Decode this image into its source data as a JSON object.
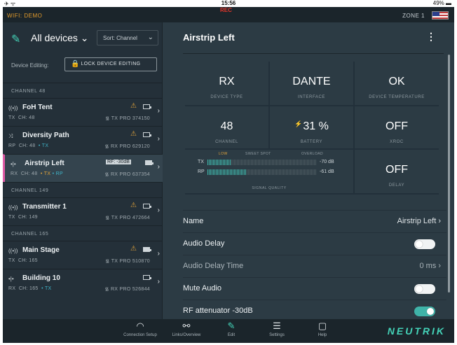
{
  "status_bar": {
    "left": "✈ ᯤ",
    "time": "15:56",
    "battery": "49% ▬"
  },
  "top_bar": {
    "wifi": "WIFI: DEMO",
    "rec": "REC",
    "zone": "ZONE 1"
  },
  "left_panel": {
    "filter_label": "All devices",
    "sort_label": "Sort: Channel",
    "device_editing_label": "Device Editing:",
    "lock_button": "LOCK DEVICE EDITING",
    "channel_headers": [
      "CHANNEL 48",
      "CHANNEL 149",
      "CHANNEL 165"
    ],
    "devices": [
      {
        "name": "FoH Tent",
        "icon": "((•))",
        "sub_role": "TX",
        "sub_ch": "CH: 48",
        "model": "TX PRO 374150"
      },
      {
        "name": "Diversity Path",
        "icon": "⤨",
        "sub_role": "RP",
        "sub_ch": "CH: 48",
        "sub_extra": "• TX",
        "model": "RX PRO 629120"
      },
      {
        "name": "Airstrip Left",
        "icon": "•|•",
        "sub_role": "RX",
        "sub_ch": "CH: 48",
        "sub_extra1": "• TX",
        "sub_extra2": "• RP",
        "model": "RX PRO 637354",
        "rf_badge": "RF: -30dB"
      },
      {
        "name": "Transmitter 1",
        "icon": "((•))",
        "sub_role": "TX",
        "sub_ch": "CH: 149",
        "model": "TX PRO 472664"
      },
      {
        "name": "Main Stage",
        "icon": "((•))",
        "sub_role": "TX",
        "sub_ch": "CH: 165",
        "model": "TX PRO 510870"
      },
      {
        "name": "Building 10",
        "icon": "•|•",
        "sub_role": "RX",
        "sub_ch": "CH: 165",
        "sub_extra": "• TX",
        "model": "RX PRO 526844"
      }
    ]
  },
  "right_panel": {
    "title": "Airstrip Left",
    "tiles": [
      {
        "value": "RX",
        "label": "DEVICE TYPE"
      },
      {
        "value": "DANTE",
        "label": "INTERFACE"
      },
      {
        "value": "OK",
        "label": "DEVICE TEMPERATURE"
      },
      {
        "value": "48",
        "label": "CHANNEL"
      },
      {
        "value": "31 %",
        "label": "BATTERY"
      },
      {
        "value": "OFF",
        "label": "XROC"
      },
      {
        "value": "OFF",
        "label": "DELAY"
      }
    ],
    "signal": {
      "zone_low": "LOW",
      "zone_sweet": "SWEET SPOT",
      "zone_over": "OVERLOAD",
      "tx_label": "TX",
      "tx_db": "-70 dB",
      "tx_level": 0.22,
      "rp_label": "RP",
      "rp_db": "-61 dB",
      "rp_level": 0.36,
      "label": "SIGNAL QUALITY"
    },
    "settings": [
      {
        "label": "Name",
        "value": "Airstrip Left ›"
      },
      {
        "label": "Audio Delay",
        "toggle": false
      },
      {
        "label": "Audio Delay Time",
        "value": "0 ms ›"
      },
      {
        "label": "Mute Audio",
        "toggle": false
      },
      {
        "label": "RF attenuator -30dB",
        "toggle": true
      }
    ]
  },
  "bottom_nav": [
    {
      "label": "Connection Setup",
      "icon": "wifi-icon"
    },
    {
      "label": "Links/Overview",
      "icon": "links-icon"
    },
    {
      "label": "Edit",
      "icon": "pen-icon",
      "active": true
    },
    {
      "label": "Settings",
      "icon": "sliders-icon"
    },
    {
      "label": "Help",
      "icon": "help-icon"
    }
  ],
  "brand": "NEUTRIK",
  "colors": {
    "accent": "#44d3b8",
    "warning": "#e2a43b",
    "selected": "#e05aa6",
    "rec": "#e1352a"
  }
}
